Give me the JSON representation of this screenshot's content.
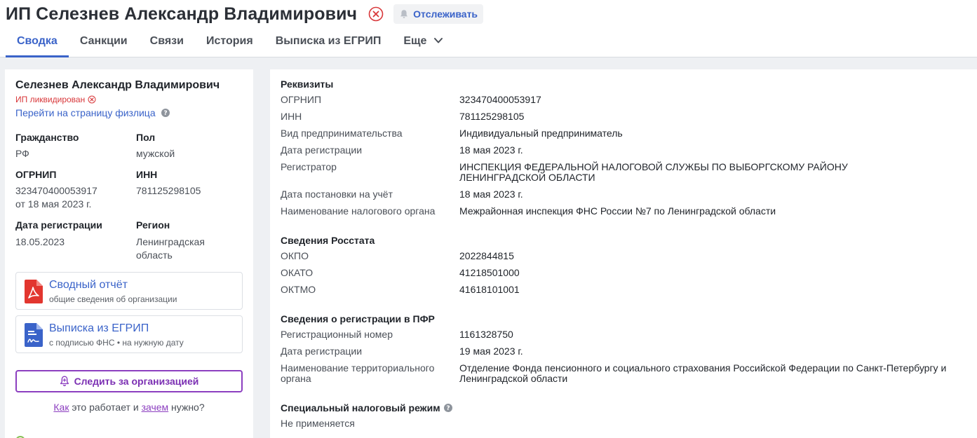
{
  "header": {
    "title": "ИП Селезнев Александр Владимирович",
    "follow_label": "Отслеживать"
  },
  "tabs": [
    {
      "label": "Сводка"
    },
    {
      "label": "Санкции"
    },
    {
      "label": "Связи"
    },
    {
      "label": "История"
    },
    {
      "label": "Выписка из ЕГРИП"
    },
    {
      "label": "Еще"
    }
  ],
  "summary": {
    "name": "Селезнев Александр Владимирович",
    "status": "ИП ликвидирован",
    "person_link": "Перейти на страницу физлица",
    "fields": {
      "citizenship_label": "Гражданство",
      "citizenship_value": "РФ",
      "sex_label": "Пол",
      "sex_value": "мужской",
      "ogrnip_label": "ОГРНИП",
      "ogrnip_value": "323470400053917",
      "ogrnip_date": "от 18 мая 2023 г.",
      "inn_label": "ИНН",
      "inn_value": "781125298105",
      "regdate_label": "Дата регистрации",
      "regdate_value": "18.05.2023",
      "region_label": "Регион",
      "region_value_1": "Ленинградская",
      "region_value_2": "область"
    },
    "cards": [
      {
        "title": "Сводный отчёт",
        "subtitle": "общие сведения об организации"
      },
      {
        "title": "Выписка из ЕГРИП",
        "subtitle": "с подписью ФНС • на нужную дату"
      }
    ],
    "watch_label": "Следить за организацией",
    "how": {
      "how": "Как",
      "middle": " это работает и ",
      "why": "зачем",
      "end": " нужно?"
    }
  },
  "details": {
    "requisites": {
      "title": "Реквизиты",
      "rows": [
        {
          "label": "ОГРНИП",
          "value": "323470400053917"
        },
        {
          "label": "ИНН",
          "value": "781125298105"
        },
        {
          "label": "Вид предпринимательства",
          "value": "Индивидуальный предприниматель"
        },
        {
          "label": "Дата регистрации",
          "value": "18 мая 2023 г."
        },
        {
          "label": "Регистратор",
          "value": "ИНСПЕКЦИЯ ФЕДЕРАЛЬНОЙ НАЛОГОВОЙ СЛУЖБЫ ПО ВЫБОРГСКОМУ РАЙОНУ ЛЕНИНГРАДСКОЙ ОБЛАСТИ"
        },
        {
          "label": "Дата постановки на учёт",
          "value": "18 мая 2023 г."
        },
        {
          "label": "Наименование налогового органа",
          "value": "Межрайонная инспекция ФНС России №7 по Ленинградской области"
        }
      ]
    },
    "rosstat": {
      "title": "Сведения Росстата",
      "rows": [
        {
          "label": "ОКПО",
          "value": "2022844815"
        },
        {
          "label": "ОКАТО",
          "value": "41218501000"
        },
        {
          "label": "ОКТМО",
          "value": "41618101001"
        }
      ]
    },
    "pfr": {
      "title": "Сведения о регистрации в ПФР",
      "rows": [
        {
          "label": "Регистрационный номер",
          "value": "1161328750"
        },
        {
          "label": "Дата регистрации",
          "value": "19 мая 2023 г."
        },
        {
          "label": "Наименование территориального органа",
          "value": "Отделение Фонда пенсионного и социального страхования Российской Федерации по Санкт-Петербургу и Ленинградской области"
        }
      ]
    },
    "tax_regime": {
      "title": "Специальный налоговый режим",
      "value": "Не применяется"
    }
  },
  "colors": {
    "accent": "#3a63c9",
    "danger": "#d8373a",
    "purple": "#8c3fc0"
  }
}
